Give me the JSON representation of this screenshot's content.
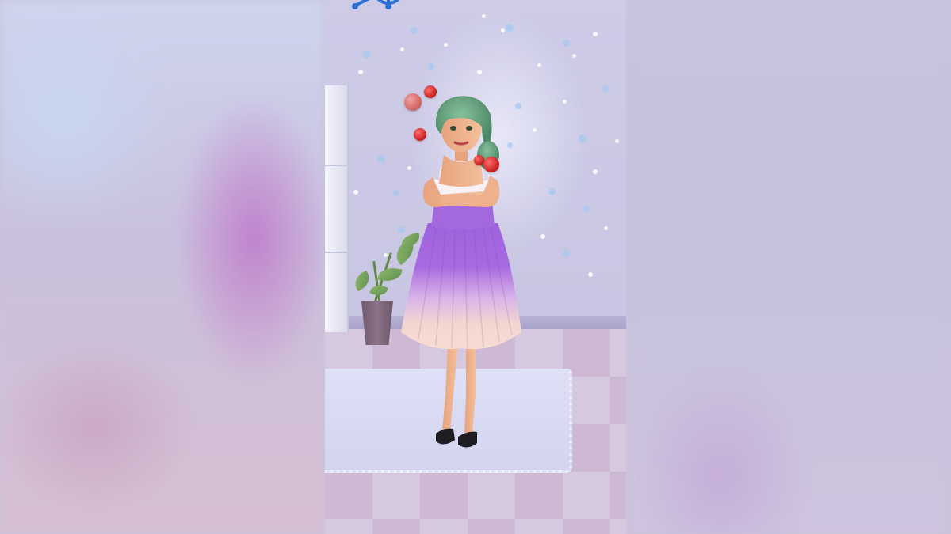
{
  "scene": {
    "name": "dress-up room",
    "colors": {
      "dress_top": "#a066e0",
      "dress_bottom": "#f6d8cf",
      "hair": "#5f9c7a",
      "wall": "#cdcbe6",
      "floor": "#d6c9df",
      "rug": "#dad8f3",
      "reaction": "#d81f1f"
    }
  },
  "hud": {
    "top_icon": "ship-wheel-icon"
  },
  "reactions": {
    "icon": "angry-face-icon",
    "count": 5
  }
}
